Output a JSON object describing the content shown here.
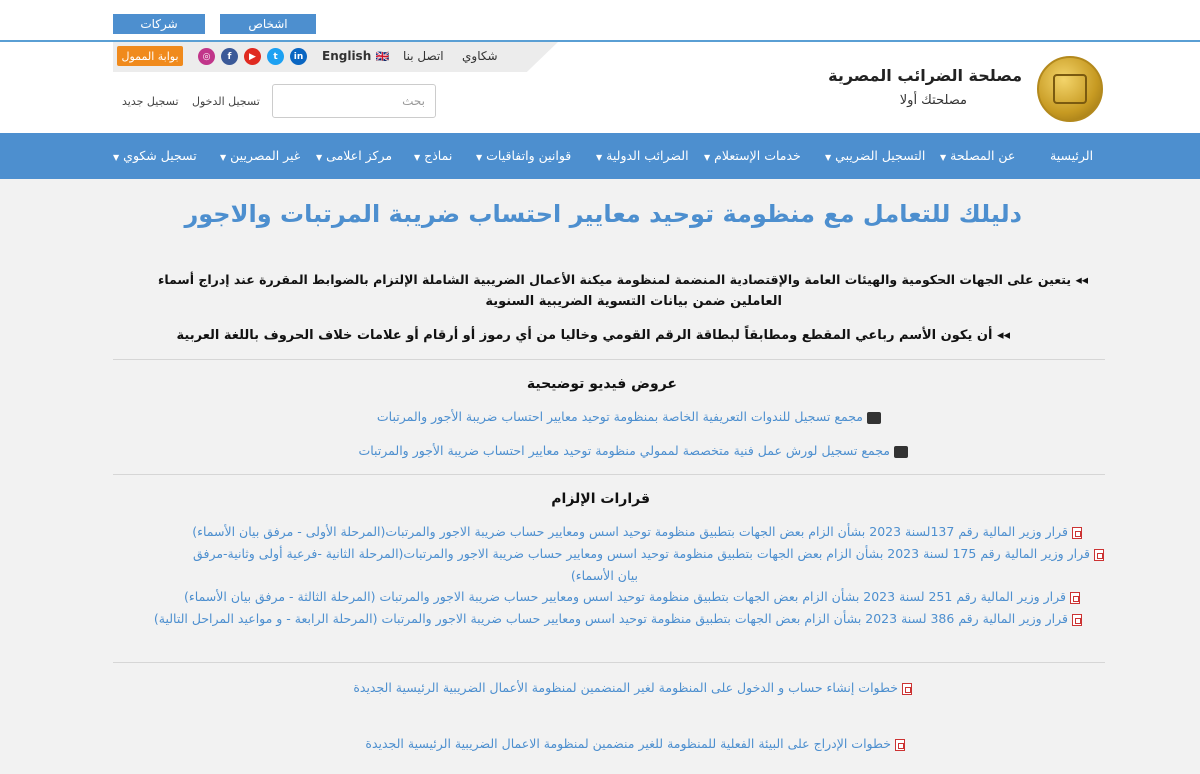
{
  "top_tabs": {
    "companies": "شركات",
    "individuals": "اشخاص"
  },
  "util_links": {
    "complaints": "شكاوي",
    "contact": "اتصل بنا",
    "english": "English",
    "flag": "🇬🇧"
  },
  "social": {
    "linkedin": "in",
    "twitter": "t",
    "youtube": "▶",
    "facebook": "f",
    "instagram": "◎"
  },
  "portal_button": "بوابة الممول",
  "search": {
    "placeholder": "بحث"
  },
  "auth": {
    "login": "تسجيل الدخول",
    "register": "تسجيل جديد"
  },
  "brand": {
    "title": "مصلحة الضرائب المصرية",
    "subtitle": "مصلحتك أولا"
  },
  "nav": {
    "home": "الرئيسية",
    "about": "عن المصلحة",
    "tax_registration": "التسجيل الضريبي",
    "inquiry_services": "خدمات الإستعلام",
    "international_taxes": "الضرائب الدولية",
    "laws": "قوانين واتفاقيات",
    "forms": "نماذج",
    "media": "مركز اعلامى",
    "non_egyptians": "غير المصريين",
    "complaint_registration": "تسجيل شكوي"
  },
  "colors": {
    "primary": "#4d8fcf",
    "portal": "#f08a1c"
  },
  "page": {
    "title": "دليلك للتعامل مع منظومة توحيد معايير احتساب ضريبة المرتبات والاجور",
    "rule1_line1": "◂◂ يتعين على الجهات الحكومية والهيئات العامة والإقتصادية المنضمة لمنظومة ميكنة الأعمال الضريبية الشاملة الإلتزام بالضوابط المقررة عند إدراج أسماء",
    "rule1_line2": "العاملين  ضمن بيانات التسوية الضريبية السنوية",
    "rule2": "◂◂ أن يكون الأسم رباعي المقطع ومطابقاً لبطاقة الرقم القومي وخاليا من أي رموز أو أرقام أو علامات خلاف الحروف باللغة العربية"
  },
  "videos": {
    "title": "عروض فيديو توضيحية",
    "link1": "مجمع تسجيل للندوات التعريفية الخاصة بمنظومة توحيد معايير احتساب ضريبة الأجور والمرتبات",
    "link2": "مجمع تسجيل لورش عمل فنية متخصصة لممولي منظومة توحيد معايير احتساب ضريبة الأجور والمرتبات"
  },
  "decisions": {
    "title": "قرارات الإلزام",
    "d1": "قرار وزير المالية رقم 137لسنة 2023 بشأن الزام بعض الجهات بتطبيق منظومة توحيد اسس ومعايير حساب ضريبة الاجور والمرتبات(المرحلة الأولى - مرفق بيان الأسماء)",
    "d2a": "قرار وزير المالية رقم 175 لسنة 2023 بشأن الزام بعض الجهات بتطبيق منظومة توحيد اسس ومعايير حساب ضريبة الاجور والمرتبات(المرحلة الثانية -فرعية أولى وثانية-مرفق",
    "d2b": "بيان الأسماء)",
    "d3": "قرار وزير المالية رقم 251 لسنة 2023 بشأن الزام بعض الجهات بتطبيق منظومة توحيد اسس ومعايير حساب ضريبة الاجور والمرتبات (المرحلة الثالثة - مرفق بيان الأسماء)",
    "d4": "قرار وزير المالية رقم 386 لسنة 2023 بشأن الزام بعض الجهات بتطبيق منظومة توحيد اسس ومعايير حساب ضريبة الاجور والمرتبات (المرحلة الرابعة - و مواعيد المراحل التالية)"
  },
  "steps": {
    "s1": "خطوات إنشاء حساب و الدخول على المنظومة لغير المنضمين لمنظومة الأعمال الضريبية الرئيسية الجديدة",
    "s2": "خطوات الإدراج على البيئة الفعلية للمنظومة للغير منضمين لمنظومة الاعمال الضريبية الرئيسية الجديدة"
  }
}
